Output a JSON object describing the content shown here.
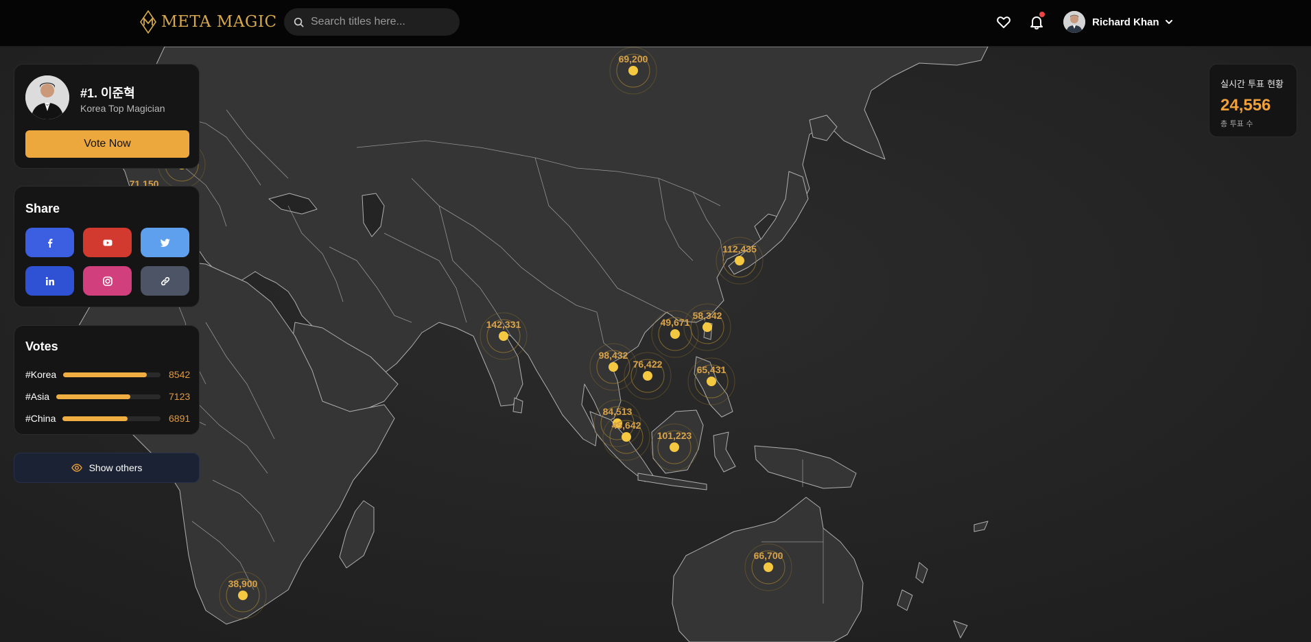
{
  "header": {
    "logo_text": "META MAGIC",
    "search_placeholder": "Search titles here...",
    "user_name": "Richard Khan",
    "icons": {
      "search": "search-icon",
      "favorites": "heart-icon",
      "notifications": "bell-icon",
      "menu": "chevron-down-icon"
    },
    "notification_dot_color": "#ef4444"
  },
  "profile_card": {
    "title": "#1. 이준혁",
    "subtitle": "Korea Top Magician",
    "vote_button": "Vote Now"
  },
  "share": {
    "title": "Share",
    "buttons": [
      {
        "icon": "facebook-icon",
        "color": "#3b5fe0"
      },
      {
        "icon": "youtube-icon",
        "color": "#d33a2f"
      },
      {
        "icon": "twitter-icon",
        "color": "#5fa0ee"
      },
      {
        "icon": "linkedin-icon",
        "color": "#2f52d4"
      },
      {
        "icon": "instagram-icon",
        "color": "#d23f7d"
      },
      {
        "icon": "link-icon",
        "color": "#4c5466"
      }
    ]
  },
  "votes": {
    "title": "Votes",
    "rows": [
      {
        "tag": "#Korea",
        "value": "8542",
        "fill": 0.86
      },
      {
        "tag": "#Asia",
        "value": "7123",
        "fill": 0.71
      },
      {
        "tag": "#China",
        "value": "6891",
        "fill": 0.66
      }
    ]
  },
  "show_others": {
    "label": "Show others",
    "icon": "eye-icon"
  },
  "stats": {
    "label": "실시간 투표 현황",
    "total": "24,556",
    "sub": "총 투표 수"
  },
  "map_markers": [
    {
      "id": "mongolia-north",
      "value": "69,200"
    },
    {
      "id": "europe-west",
      "value": "71,150"
    },
    {
      "id": "korea",
      "value": "112,435"
    },
    {
      "id": "india",
      "value": "142,331"
    },
    {
      "id": "vietnam-north",
      "value": "49,671"
    },
    {
      "id": "taiwan",
      "value": "58,342"
    },
    {
      "id": "thailand",
      "value": "98,432"
    },
    {
      "id": "cambodia",
      "value": "76,422"
    },
    {
      "id": "philippines",
      "value": "65,431"
    },
    {
      "id": "malaysia",
      "value": "84,513"
    },
    {
      "id": "singapore",
      "value": "45,642"
    },
    {
      "id": "borneo",
      "value": "101,223"
    },
    {
      "id": "australia",
      "value": "66,700"
    },
    {
      "id": "south-africa",
      "value": "38,900"
    }
  ],
  "colors": {
    "accent": "#eca73d",
    "marker": "#f5c842",
    "marker_text": "#d8a24a",
    "land": "#353535",
    "border": "#a9a9a9"
  }
}
